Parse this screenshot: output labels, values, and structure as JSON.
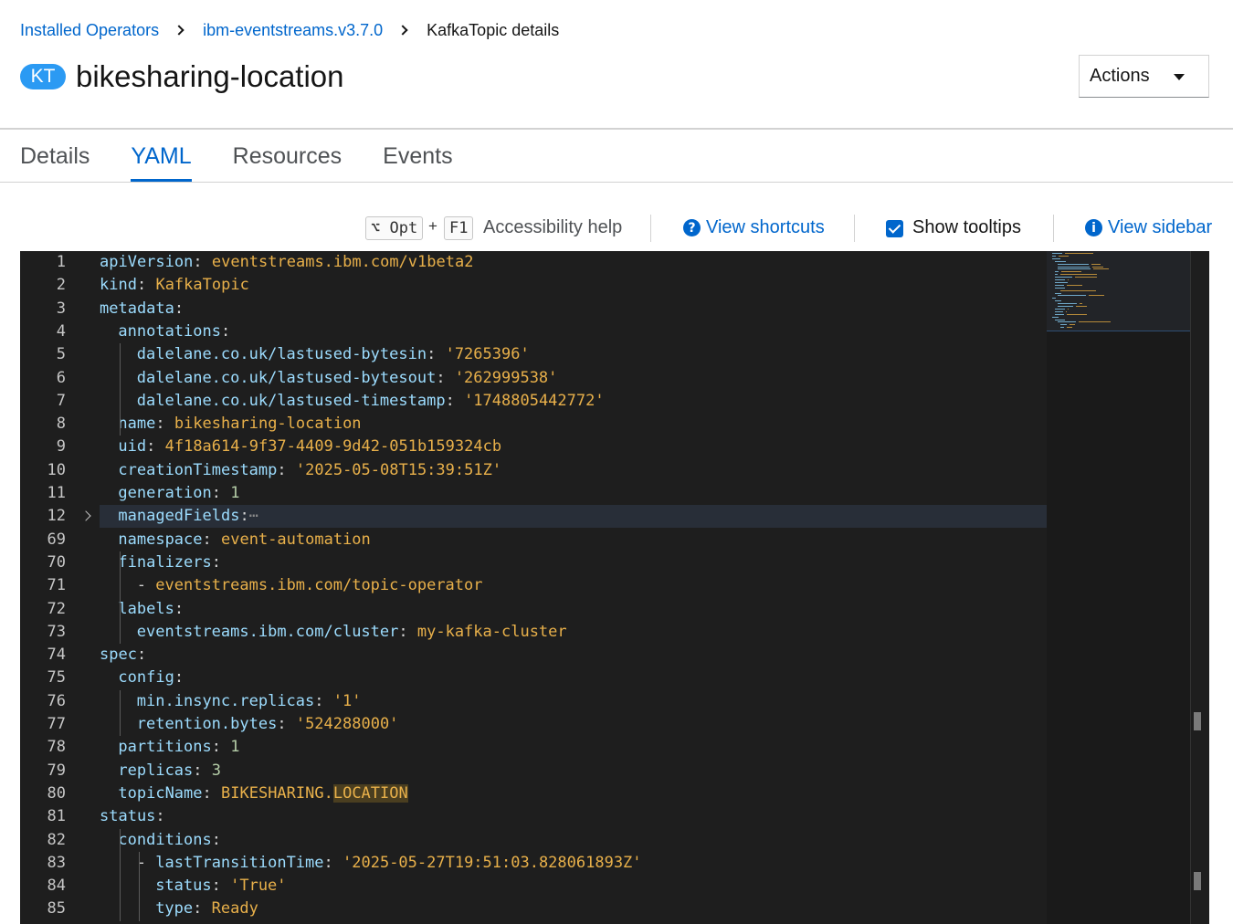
{
  "breadcrumb": {
    "items": [
      "Installed Operators",
      "ibm-eventstreams.v3.7.0"
    ],
    "current": "KafkaTopic details"
  },
  "header": {
    "badge": "KT",
    "title": "bikesharing-location",
    "actions_label": "Actions"
  },
  "tabs": [
    {
      "label": "Details",
      "active": false
    },
    {
      "label": "YAML",
      "active": true
    },
    {
      "label": "Resources",
      "active": false
    },
    {
      "label": "Events",
      "active": false
    }
  ],
  "toolbar": {
    "kbd_opt": "⌥ Opt",
    "kbd_plus": "+",
    "kbd_f1": "F1",
    "accessibility_help": "Accessibility help",
    "view_shortcuts": "View shortcuts",
    "show_tooltips": "Show tooltips",
    "show_tooltips_checked": true,
    "view_sidebar": "View sidebar"
  },
  "editor": {
    "highlight_line": "12",
    "lines": [
      {
        "n": "1",
        "i": 0,
        "k": "apiVersion",
        "v": "eventstreams.ibm.com/v1beta2"
      },
      {
        "n": "2",
        "i": 0,
        "k": "kind",
        "v": "KafkaTopic"
      },
      {
        "n": "3",
        "i": 0,
        "k": "metadata",
        "v": ""
      },
      {
        "n": "4",
        "i": 1,
        "k": "annotations",
        "v": ""
      },
      {
        "n": "5",
        "i": 2,
        "k": "dalelane.co.uk/lastused-bytesin",
        "v": "'7265396'"
      },
      {
        "n": "6",
        "i": 2,
        "k": "dalelane.co.uk/lastused-bytesout",
        "v": "'262999538'"
      },
      {
        "n": "7",
        "i": 2,
        "k": "dalelane.co.uk/lastused-timestamp",
        "v": "'1748805442772'"
      },
      {
        "n": "8",
        "i": 1,
        "k": "name",
        "v": "bikesharing-location"
      },
      {
        "n": "9",
        "i": 1,
        "k": "uid",
        "v": "4f18a614-9f37-4409-9d42-051b159324cb"
      },
      {
        "n": "10",
        "i": 1,
        "k": "creationTimestamp",
        "v": "'2025-05-08T15:39:51Z'"
      },
      {
        "n": "11",
        "i": 1,
        "k": "generation",
        "v": "1",
        "num": true
      },
      {
        "n": "12",
        "i": 1,
        "k": "managedFields",
        "v": "",
        "folded": true
      },
      {
        "n": "69",
        "i": 1,
        "k": "namespace",
        "v": "event-automation"
      },
      {
        "n": "70",
        "i": 1,
        "k": "finalizers",
        "v": ""
      },
      {
        "n": "71",
        "i": 2,
        "k": "",
        "v": "eventstreams.ibm.com/topic-operator",
        "dash": true
      },
      {
        "n": "72",
        "i": 1,
        "k": "labels",
        "v": ""
      },
      {
        "n": "73",
        "i": 2,
        "k": "eventstreams.ibm.com/cluster",
        "v": "my-kafka-cluster"
      },
      {
        "n": "74",
        "i": 0,
        "k": "spec",
        "v": ""
      },
      {
        "n": "75",
        "i": 1,
        "k": "config",
        "v": ""
      },
      {
        "n": "76",
        "i": 2,
        "k": "min.insync.replicas",
        "v": "'1'"
      },
      {
        "n": "77",
        "i": 2,
        "k": "retention.bytes",
        "v": "'524288000'"
      },
      {
        "n": "78",
        "i": 1,
        "k": "partitions",
        "v": "1",
        "num": true
      },
      {
        "n": "79",
        "i": 1,
        "k": "replicas",
        "v": "3",
        "num": true
      },
      {
        "n": "80",
        "i": 1,
        "k": "topicName",
        "v": "BIKESHARING.LOCATION",
        "vhl": true
      },
      {
        "n": "81",
        "i": 0,
        "k": "status",
        "v": ""
      },
      {
        "n": "82",
        "i": 1,
        "k": "conditions",
        "v": ""
      },
      {
        "n": "83",
        "i": 2,
        "k": "lastTransitionTime",
        "v": "'2025-05-27T19:51:03.828061893Z'",
        "dash": true
      },
      {
        "n": "84",
        "i": 3,
        "k": "status",
        "v": "'True'"
      },
      {
        "n": "85",
        "i": 3,
        "k": "type",
        "v": "Ready"
      }
    ]
  },
  "colors": {
    "link": "#0066cc",
    "badge": "#2b9af3",
    "editor_bg": "#1e1e1e",
    "yaml_key": "#9cdcfe",
    "yaml_value": "#e8b04a",
    "yaml_number": "#b5cea8"
  },
  "icons": {
    "view_shortcuts": "question-circle-icon",
    "view_sidebar": "info-circle-icon",
    "actions": "caret-down-icon",
    "breadcrumb_separator": "angle-right-icon",
    "fold": "chevron-right-icon"
  }
}
